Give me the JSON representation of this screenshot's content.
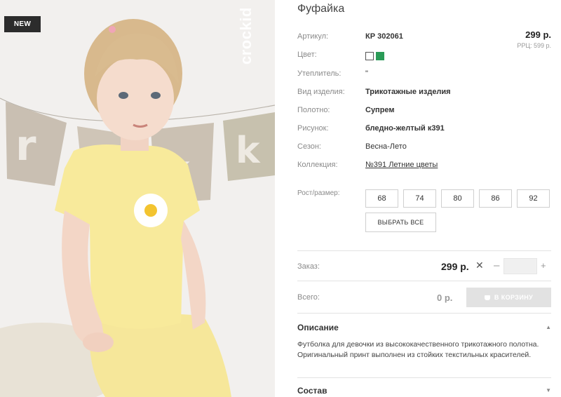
{
  "badge": {
    "label": "NEW"
  },
  "brand": {
    "logo_text": "crockid"
  },
  "product": {
    "title": "Фуфайка",
    "price": "299 р.",
    "rrp": "РРЦ: 599 р.",
    "attributes": [
      {
        "label": "Артикул:",
        "value": "КР 302061"
      },
      {
        "label": "Цвет:",
        "value": ""
      },
      {
        "label": "Утеплитель:",
        "value": "\""
      },
      {
        "label": "Вид изделия:",
        "value": "Трикотажные изделия"
      },
      {
        "label": "Полотно:",
        "value": "Супрем"
      },
      {
        "label": "Рисунок:",
        "value": "бледно-желтый к391"
      },
      {
        "label": "Сезон:",
        "value": "Весна-Лето"
      },
      {
        "label": "Коллекция:",
        "value": "№391 Летние цветы"
      }
    ],
    "colors": [
      "#ffffff",
      "#2a9b57"
    ]
  },
  "sizes": {
    "label": "Рост/размер:",
    "options": [
      "68",
      "74",
      "80",
      "86",
      "92"
    ],
    "select_all": "ВЫБРАТЬ ВСЕ"
  },
  "order": {
    "label": "Заказ:",
    "price": "299 р.",
    "times": "✕",
    "minus": "–",
    "plus": "+",
    "quantity": ""
  },
  "total": {
    "label": "Всего:",
    "value": "0 р.",
    "cart_button": "В КОРЗИНУ"
  },
  "description": {
    "title": "Описание",
    "text": "Футболка для девочки из высококачественного трикотажного полотна. Оригинальный принт выполнен из стойких текстильных красителей."
  },
  "composition": {
    "title": "Состав"
  },
  "colors": {
    "accent_green": "#2a9b57",
    "button_disabled": "#e2e2e2",
    "badge_bg": "#2c2c2c"
  }
}
